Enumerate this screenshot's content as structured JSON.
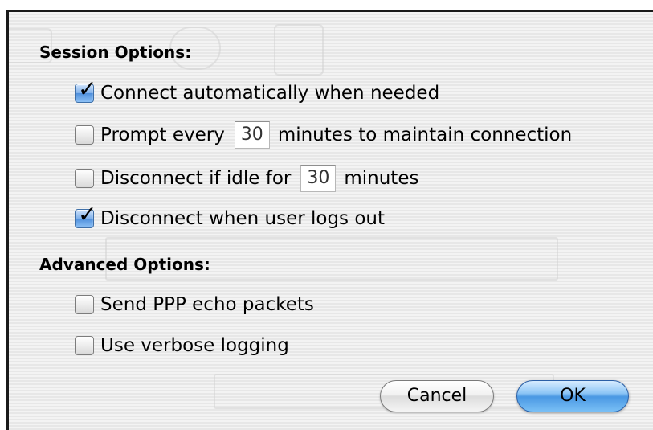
{
  "session_options": {
    "title": "Session Options:",
    "connect_auto": {
      "label": "Connect automatically when needed",
      "checked": true
    },
    "prompt_every": {
      "label_before": "Prompt every",
      "value": "30",
      "label_after": "minutes to maintain connection",
      "checked": false
    },
    "disconnect_idle": {
      "label_before": "Disconnect if idle for",
      "value": "30",
      "label_after": "minutes",
      "checked": false
    },
    "disconnect_logout": {
      "label": "Disconnect when user logs out",
      "checked": true
    }
  },
  "advanced_options": {
    "title": "Advanced Options:",
    "echo_packets": {
      "label": "Send PPP echo packets",
      "checked": false
    },
    "verbose_logging": {
      "label": "Use verbose logging",
      "checked": false
    }
  },
  "buttons": {
    "cancel": "Cancel",
    "ok": "OK"
  },
  "colors": {
    "ok_button": "#4a98e3",
    "checkbox_checked": "#4f8fdc"
  }
}
